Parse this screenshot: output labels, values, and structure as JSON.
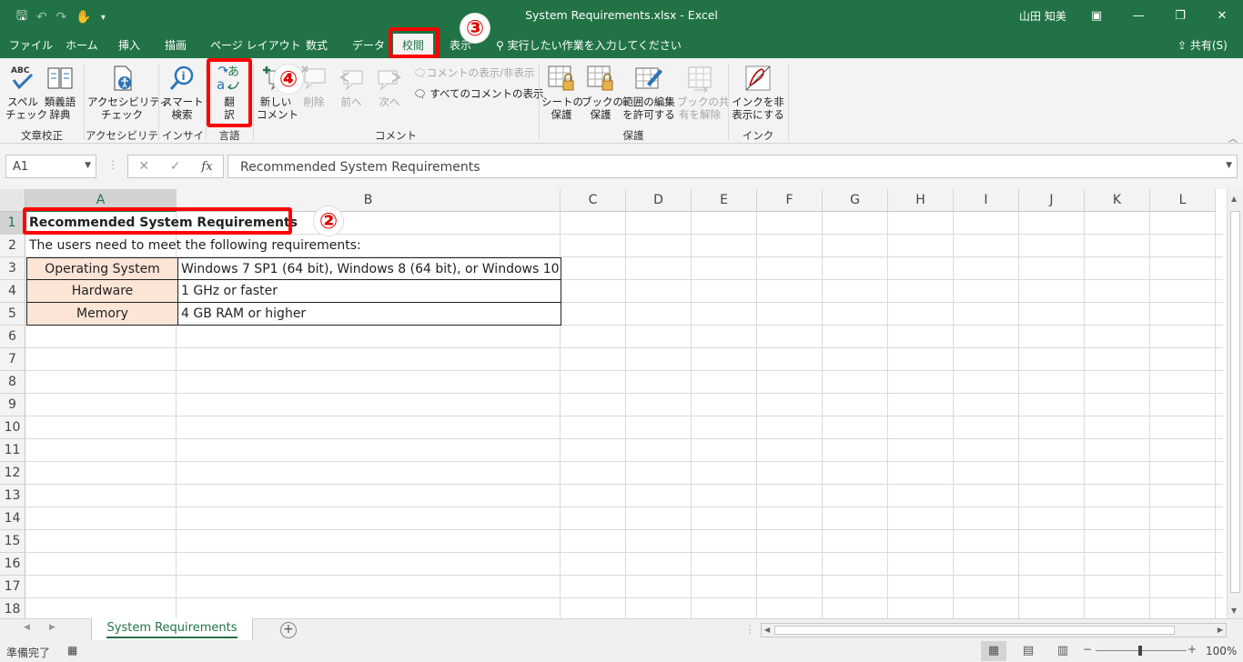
{
  "window": {
    "title": "System Requirements.xlsx  -  Excel",
    "user": "山田 知美"
  },
  "ribbon_tabs": [
    "ファイル",
    "ホーム",
    "挿入",
    "描画",
    "ページ レイアウト",
    "数式",
    "データ",
    "校閲",
    "表示"
  ],
  "active_tab": "校閲",
  "tellme": "実行したい作業を入力してください",
  "share": "共有(S)",
  "ribbon": {
    "spelling": "スペル\nチェック",
    "thesaurus": "類義語\n辞典",
    "accessibility": "アクセシビリティ\nチェック",
    "smart_lookup": "スマート\n検索",
    "translate": "翻\n訳",
    "new_comment": "新しい\nコメント",
    "delete": "削除",
    "previous": "前へ",
    "next": "次へ",
    "show_hide_comment": "コメントの表示/非表示",
    "show_all_comments": "すべてのコメントの表示",
    "protect_sheet": "シートの\n保護",
    "protect_workbook": "ブックの\n保護",
    "allow_edit_ranges": "範囲の編集\nを許可する",
    "unshare_workbook": "ブックの共\n有を解除",
    "hide_ink": "インクを非\n表示にする",
    "groups": {
      "proofing": "文章校正",
      "accessibility": "アクセシビリティ",
      "insights": "インサイト",
      "language": "言語",
      "comments": "コメント",
      "protect": "保護",
      "ink": "インク"
    }
  },
  "formula_bar": {
    "name_box": "A1",
    "fx": "fx",
    "formula": "Recommended System Requirements"
  },
  "columns": [
    "A",
    "B",
    "C",
    "D",
    "E",
    "F",
    "G",
    "H",
    "I",
    "J",
    "K",
    "L"
  ],
  "rows": [
    "1",
    "2",
    "3",
    "4",
    "5",
    "6",
    "7",
    "8",
    "9",
    "10",
    "11",
    "12",
    "13",
    "14",
    "15",
    "16",
    "17",
    "18"
  ],
  "sheet": {
    "a1": "Recommended System Requirements",
    "a2": "The users need to meet the following requirements:",
    "table": [
      {
        "label": "Operating System",
        "value": "Windows 7 SP1 (64 bit), Windows 8 (64 bit), or Windows 10"
      },
      {
        "label": "Hardware",
        "value": "1 GHz or faster"
      },
      {
        "label": "Memory",
        "value": "4 GB RAM or higher"
      }
    ]
  },
  "sheet_tab": "System Requirements",
  "status": {
    "ready": "準備完了",
    "zoom": "100%"
  },
  "annotations": {
    "m2": "②",
    "m3": "③",
    "m4": "④"
  },
  "colors": {
    "excel_green": "#217346",
    "callout_red": "#ff0000",
    "label_fill": "#fce4d6"
  }
}
